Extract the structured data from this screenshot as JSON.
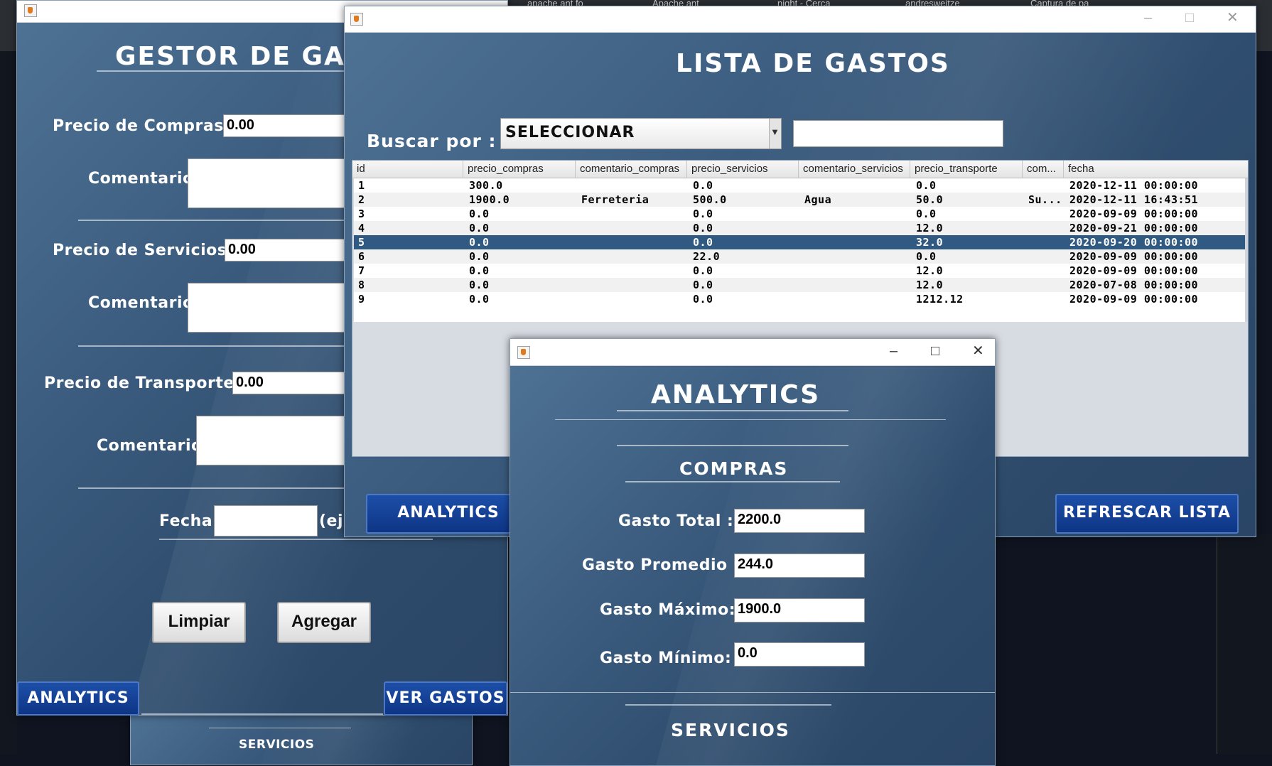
{
  "browser": {
    "tabs": [
      "apache ant fo",
      "Apache ant",
      "night - Cerca",
      "andresweitze",
      "Captura de pa"
    ]
  },
  "gestor": {
    "title": "GESTOR DE GASTOS",
    "compras_label": "Precio de Compras: $",
    "compras_value": "0.00",
    "comentario1_label": "Comentario :",
    "servicios_label": "Precio de Servicios: $",
    "servicios_value": "0.00",
    "comentario2_label": "Comentario :",
    "transporte_label": "Precio de Transporte: $",
    "transporte_value": "0.00",
    "comentario3_label": "Comentario :",
    "fecha_label": "Fecha:",
    "fecha_hint": "(ej:",
    "limpiar_label": "Limpiar",
    "agregar_label": "Agregar",
    "analytics_label": "ANALYTICS",
    "ver_gastos_label": "VER GASTOS"
  },
  "lista": {
    "title": "LISTA DE GASTOS",
    "buscar_label": "Buscar por :",
    "select_value": "SELECCIONAR",
    "search_value": "",
    "columns": [
      "id",
      "precio_compras",
      "comentario_compras",
      "precio_servicios",
      "comentario_servicios",
      "precio_transporte",
      "com...",
      "fecha"
    ],
    "rows": [
      [
        "1",
        "300.0",
        "",
        "0.0",
        "",
        "0.0",
        "",
        "2020-12-11 00:00:00"
      ],
      [
        "2",
        "1900.0",
        "Ferreteria",
        "500.0",
        "Agua",
        "50.0",
        "Su...",
        "2020-12-11 16:43:51"
      ],
      [
        "3",
        "0.0",
        "",
        "0.0",
        "",
        "0.0",
        "",
        "2020-09-09 00:00:00"
      ],
      [
        "4",
        "0.0",
        "",
        "0.0",
        "",
        "12.0",
        "",
        "2020-09-21 00:00:00"
      ],
      [
        "5",
        "0.0",
        "",
        "0.0",
        "",
        "32.0",
        "",
        "2020-09-20 00:00:00"
      ],
      [
        "6",
        "0.0",
        "",
        "22.0",
        "",
        "0.0",
        "",
        "2020-09-09 00:00:00"
      ],
      [
        "7",
        "0.0",
        "",
        "0.0",
        "",
        "12.0",
        "",
        "2020-09-09 00:00:00"
      ],
      [
        "8",
        "0.0",
        "",
        "0.0",
        "",
        "12.0",
        "",
        "2020-07-08 00:00:00"
      ],
      [
        "9",
        "0.0",
        "",
        "0.0",
        "",
        "1212.12",
        "",
        "2020-09-09 00:00:00"
      ]
    ],
    "selected_row_index": 4,
    "analytics_label": "ANALYTICS",
    "refrescar_label": "REFRESCAR LISTA"
  },
  "analytics": {
    "title": "ANALYTICS",
    "compras_heading": "COMPRAS",
    "gasto_total_label": "Gasto Total : $",
    "gasto_total_value": "2200.0",
    "gasto_promedio_label": "Gasto Promedio : $",
    "gasto_promedio_value": "244.0",
    "gasto_maximo_label": "Gasto Máximo: $",
    "gasto_maximo_value": "1900.0",
    "gasto_minimo_label": "Gasto Mínimo: $",
    "gasto_minimo_value": "0.0",
    "servicios_heading": "SERVICIOS"
  },
  "behind_window": {
    "servicios_heading": "SERVICIOS"
  },
  "colors": {
    "panel_blue": "#3c5d80",
    "button_blue": "#0e3585",
    "selected_row": "#305a82"
  }
}
